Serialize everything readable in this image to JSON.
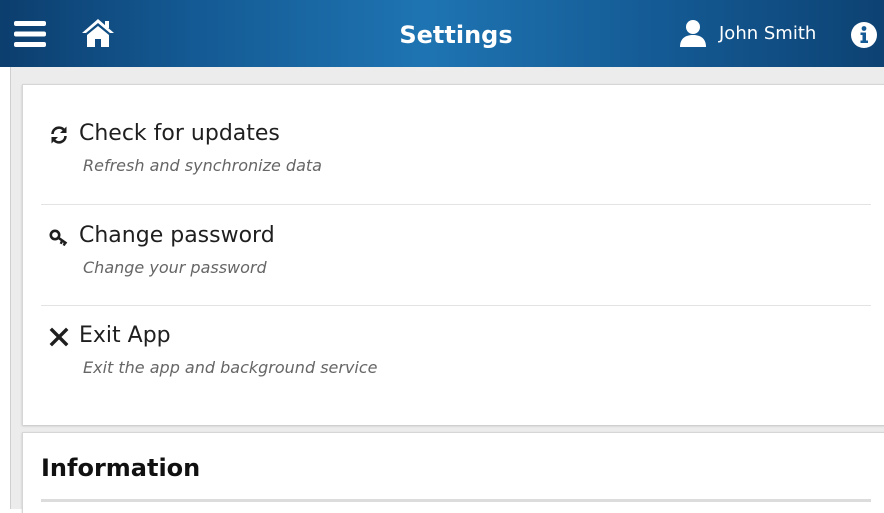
{
  "header": {
    "title": "Settings",
    "user_name": "John Smith",
    "menu_icon": "hamburger-menu-icon",
    "home_icon": "home-icon",
    "user_icon": "user-icon",
    "info_icon": "info-icon"
  },
  "settings": {
    "items": [
      {
        "icon": "refresh-icon",
        "label": "Check for updates",
        "description": "Refresh and synchronize data"
      },
      {
        "icon": "key-icon",
        "label": "Change password",
        "description": "Change your password"
      },
      {
        "icon": "close-icon",
        "label": "Exit App",
        "description": "Exit the app and background service"
      }
    ]
  },
  "information": {
    "heading": "Information"
  },
  "colors": {
    "header_gradient_dark": "#0c3e6e",
    "header_gradient_light": "#1e74b2",
    "header_text": "#ffffff",
    "label_text": "#1f1f1f",
    "description_text": "#666666"
  }
}
